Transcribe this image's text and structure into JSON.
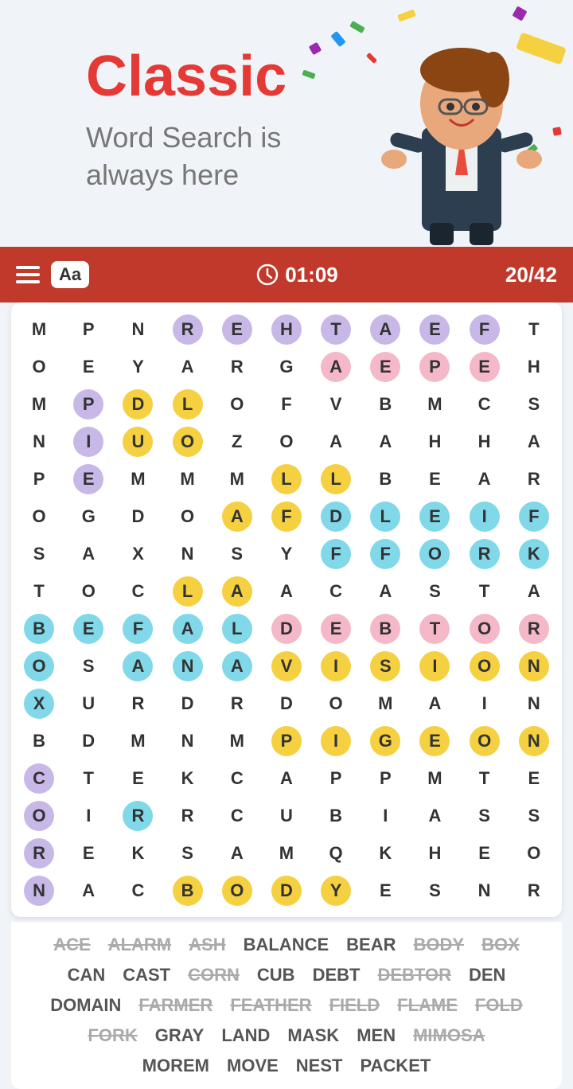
{
  "header": {
    "title": "Classic",
    "subtitle_line1": "Word Search is",
    "subtitle_line2": "always here"
  },
  "toolbar": {
    "font_label": "Aa",
    "timer": "01:09",
    "score": "20/42"
  },
  "grid": {
    "rows": [
      [
        "M",
        "P",
        "N",
        "R",
        "E",
        "H",
        "T",
        "A",
        "E",
        "F",
        "T"
      ],
      [
        "O",
        "E",
        "Y",
        "A",
        "R",
        "G",
        "A",
        "E",
        "P",
        "E",
        "H"
      ],
      [
        "M",
        "P",
        "D",
        "L",
        "O",
        "F",
        "V",
        "B",
        "M",
        "C",
        "S"
      ],
      [
        "N",
        "I",
        "U",
        "O",
        "Z",
        "O",
        "A",
        "A",
        "H",
        "H",
        "A"
      ],
      [
        "P",
        "E",
        "M",
        "M",
        "M",
        "L",
        "L",
        "B",
        "E",
        "A",
        "R"
      ],
      [
        "O",
        "G",
        "D",
        "O",
        "A",
        "F",
        "D",
        "L",
        "E",
        "I",
        "F"
      ],
      [
        "S",
        "A",
        "X",
        "N",
        "S",
        "Y",
        "F",
        "F",
        "O",
        "R",
        "K"
      ],
      [
        "T",
        "O",
        "C",
        "L",
        "A",
        "A",
        "C",
        "A",
        "S",
        "T",
        "A"
      ],
      [
        "B",
        "E",
        "F",
        "A",
        "L",
        "D",
        "E",
        "B",
        "T",
        "O",
        "R"
      ],
      [
        "O",
        "S",
        "A",
        "N",
        "A",
        "V",
        "I",
        "S",
        "I",
        "O",
        "N"
      ],
      [
        "X",
        "U",
        "R",
        "D",
        "R",
        "D",
        "O",
        "M",
        "A",
        "I",
        "N"
      ],
      [
        "B",
        "D",
        "M",
        "N",
        "M",
        "P",
        "I",
        "G",
        "E",
        "O",
        "N"
      ],
      [
        "C",
        "T",
        "E",
        "K",
        "C",
        "A",
        "P",
        "P",
        "M",
        "T",
        "E"
      ],
      [
        "O",
        "I",
        "R",
        "R",
        "C",
        "U",
        "B",
        "I",
        "A",
        "S",
        "S"
      ],
      [
        "R",
        "E",
        "K",
        "S",
        "A",
        "M",
        "Q",
        "K",
        "H",
        "E",
        "O"
      ],
      [
        "N",
        "A",
        "C",
        "B",
        "O",
        "D",
        "Y",
        "E",
        "S",
        "N",
        "R"
      ]
    ],
    "highlights": {
      "rehtaef": {
        "color": "hl-purple",
        "cells": [
          [
            0,
            3
          ],
          [
            0,
            4
          ],
          [
            0,
            5
          ],
          [
            0,
            6
          ],
          [
            0,
            7
          ],
          [
            0,
            8
          ],
          [
            0,
            9
          ]
        ]
      },
      "epeh": {
        "color": "hl-pink",
        "cells": [
          [
            1,
            7
          ],
          [
            1,
            8
          ],
          [
            1,
            9
          ],
          [
            1,
            10
          ]
        ]
      },
      "vision": {
        "color": "hl-yellow",
        "cells": [
          [
            9,
            5
          ],
          [
            9,
            6
          ],
          [
            9,
            7
          ],
          [
            9,
            8
          ],
          [
            9,
            9
          ],
          [
            9,
            10
          ]
        ]
      },
      "debtor": {
        "color": "hl-pink",
        "cells": [
          [
            8,
            5
          ],
          [
            8,
            6
          ],
          [
            8,
            7
          ],
          [
            8,
            8
          ],
          [
            8,
            9
          ],
          [
            8,
            10
          ]
        ]
      },
      "pigeon": {
        "color": "hl-yellow",
        "cells": [
          [
            11,
            5
          ],
          [
            11,
            6
          ],
          [
            11,
            7
          ],
          [
            11,
            8
          ],
          [
            11,
            9
          ],
          [
            11,
            10
          ]
        ]
      },
      "fork": {
        "color": "hl-cyan",
        "cells": [
          [
            6,
            7
          ],
          [
            6,
            8
          ],
          [
            6,
            9
          ],
          [
            6,
            10
          ]
        ]
      },
      "body": {
        "color": "hl-yellow",
        "cells": [
          [
            15,
            3
          ],
          [
            15,
            4
          ],
          [
            15,
            5
          ],
          [
            15,
            6
          ]
        ]
      },
      "box": {
        "color": "hl-cyan",
        "cells": [
          [
            8,
            0
          ],
          [
            9,
            0
          ],
          [
            10,
            0
          ]
        ]
      },
      "bear_diag": {
        "color": "hl-purple",
        "cells": [
          [
            1,
            1
          ],
          [
            2,
            1
          ],
          [
            3,
            1
          ],
          [
            4,
            1
          ]
        ]
      },
      "corn_diag": {
        "color": "hl-purple",
        "cells": [
          [
            12,
            0
          ],
          [
            13,
            0
          ],
          [
            14,
            0
          ],
          [
            15,
            0
          ]
        ]
      },
      "field_diag": {
        "color": "hl-yellow",
        "cells": [
          [
            4,
            7
          ],
          [
            5,
            7
          ],
          [
            6,
            7
          ],
          [
            6,
            8
          ],
          [
            6,
            9
          ]
        ]
      },
      "ana": {
        "color": "hl-cyan",
        "cells": [
          [
            9,
            2
          ],
          [
            9,
            3
          ],
          [
            9,
            4
          ]
        ]
      }
    }
  },
  "word_list": {
    "rows": [
      [
        {
          "text": "ACE",
          "found": true
        },
        {
          "text": "ALARM",
          "found": true
        },
        {
          "text": "ASH",
          "found": true
        },
        {
          "text": "BALANCE",
          "found": false
        },
        {
          "text": "BEAR",
          "found": false
        },
        {
          "text": "BODY",
          "found": true
        },
        {
          "text": "BOX",
          "found": true
        }
      ],
      [
        {
          "text": "CAN",
          "found": false
        },
        {
          "text": "CAST",
          "found": false
        },
        {
          "text": "CORN",
          "found": true
        },
        {
          "text": "CUB",
          "found": false
        },
        {
          "text": "DEBT",
          "found": false
        },
        {
          "text": "DEBTOR",
          "found": true
        },
        {
          "text": "DEN",
          "found": false
        }
      ],
      [
        {
          "text": "DOMAIN",
          "found": false
        },
        {
          "text": "FARMER",
          "found": true
        },
        {
          "text": "FEATHER",
          "found": true
        },
        {
          "text": "FIELD",
          "found": true
        },
        {
          "text": "FLAME",
          "found": true
        },
        {
          "text": "FOLD",
          "found": true
        }
      ],
      [
        {
          "text": "FORK",
          "found": true
        },
        {
          "text": "GRAY",
          "found": false
        },
        {
          "text": "LAND",
          "found": false
        },
        {
          "text": "MASK",
          "found": false
        },
        {
          "text": "MEN",
          "found": false
        },
        {
          "text": "MIMOSA",
          "found": true
        }
      ],
      [
        {
          "text": "MOREM",
          "found": false
        },
        {
          "text": "MOVE",
          "found": false
        },
        {
          "text": "NEST",
          "found": false
        },
        {
          "text": "PACKET",
          "found": false
        }
      ]
    ]
  }
}
